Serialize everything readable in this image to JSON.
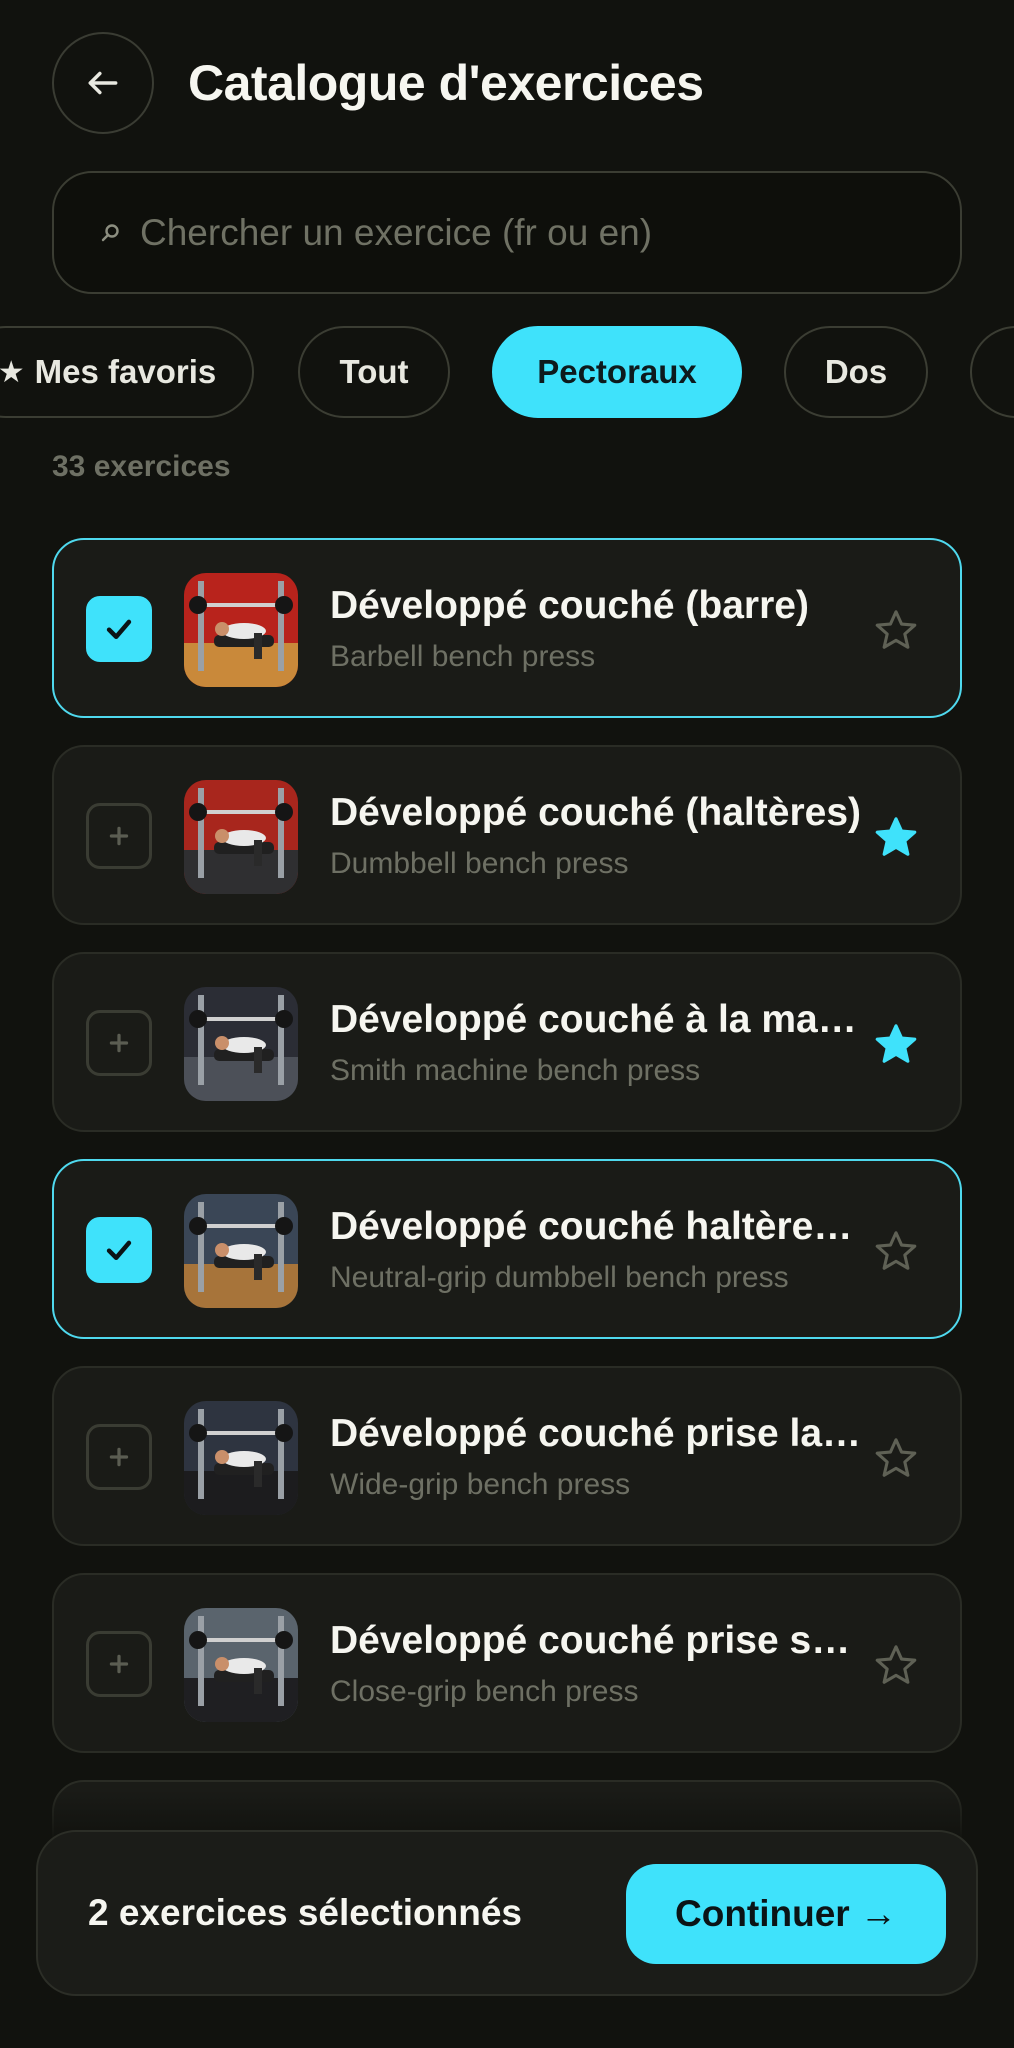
{
  "header": {
    "title": "Catalogue d'exercices",
    "back_icon": "arrow-left-icon"
  },
  "search": {
    "placeholder": "Chercher un exercice (fr ou en)",
    "value": ""
  },
  "filters": {
    "chips": [
      {
        "label": "Mes favoris",
        "icon": "star-icon",
        "active": false
      },
      {
        "label": "Tout",
        "active": false
      },
      {
        "label": "Pectoraux",
        "active": true
      },
      {
        "label": "Dos",
        "active": false
      },
      {
        "label": "",
        "active": false
      }
    ]
  },
  "count_label": "33 exercices",
  "exercises": [
    {
      "title": "Développé couché (barre)",
      "subtitle": "Barbell bench press",
      "selected": true,
      "favorite": false
    },
    {
      "title": "Développé couché (haltères)",
      "subtitle": "Dumbbell bench press",
      "selected": false,
      "favorite": true
    },
    {
      "title": "Développé couché à la machine Smith",
      "subtitle": "Smith machine bench press",
      "selected": false,
      "favorite": true
    },
    {
      "title": "Développé couché haltères prise neutre",
      "subtitle": "Neutral-grip dumbbell bench press",
      "selected": true,
      "favorite": false
    },
    {
      "title": "Développé couché prise large",
      "subtitle": "Wide-grip bench press",
      "selected": false,
      "favorite": false
    },
    {
      "title": "Développé couché prise serrée",
      "subtitle": "Close-grip bench press",
      "selected": false,
      "favorite": false
    }
  ],
  "bottom": {
    "selected_label": "2 exercices sélectionnés",
    "continue_label": "Continuer →"
  },
  "colors": {
    "accent": "#3fe2fb",
    "background": "#11120e",
    "card": "#1a1b17",
    "muted": "#6e7064"
  }
}
